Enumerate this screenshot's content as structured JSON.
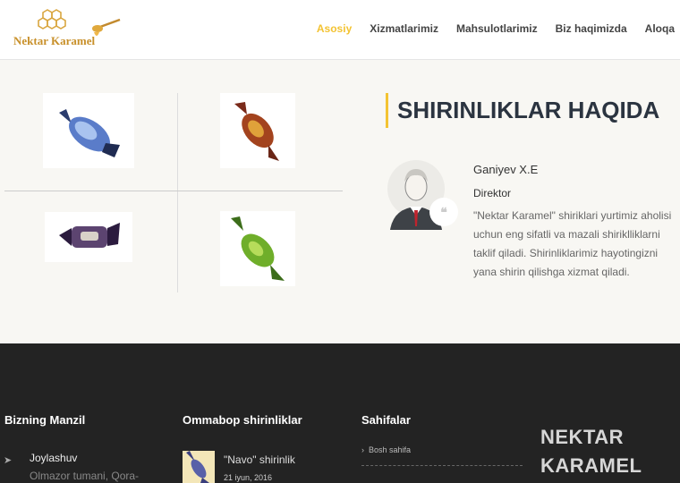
{
  "header": {
    "logo_text": "Nektar Karamel",
    "nav": [
      {
        "label": "Asosiy",
        "active": true
      },
      {
        "label": "Xizmatlarimiz",
        "active": false
      },
      {
        "label": "Mahsulotlarimiz",
        "active": false
      },
      {
        "label": "Biz haqimizda",
        "active": false
      },
      {
        "label": "Aloqa",
        "active": false
      }
    ]
  },
  "about": {
    "title_light": "SHIRINLIKLAR",
    "title_bold": "HAQIDA",
    "person": {
      "name": "Ganiyev X.E",
      "role": "Direktor",
      "text": "\"Nektar Karamel\" shiriklari yurtimiz aholisi uchun eng sifatli va mazali shiriklliklarni taklif qiladi. Shirinliklarimiz hayotingizni yana shirin qilishga xizmat qiladi."
    },
    "quote_icon": "quote-icon"
  },
  "footer": {
    "col1": {
      "heading": "Bizning Manzil",
      "location_title": "Joylashuv",
      "location_address": "Olmazor tumani, Qora-"
    },
    "col2": {
      "heading": "Ommabop shirinliklar",
      "post_title": "\"Navo\" shirinlik",
      "post_date": "21 iyun, 2016"
    },
    "col3": {
      "heading": "Sahifalar",
      "items": [
        "Bosh sahifa"
      ]
    },
    "brand": "NEKTAR KARAMEL"
  },
  "colors": {
    "accent": "#f3c332",
    "footer_bg": "#232323",
    "section_bg": "#f8f7f3",
    "title": "#2b3440"
  }
}
